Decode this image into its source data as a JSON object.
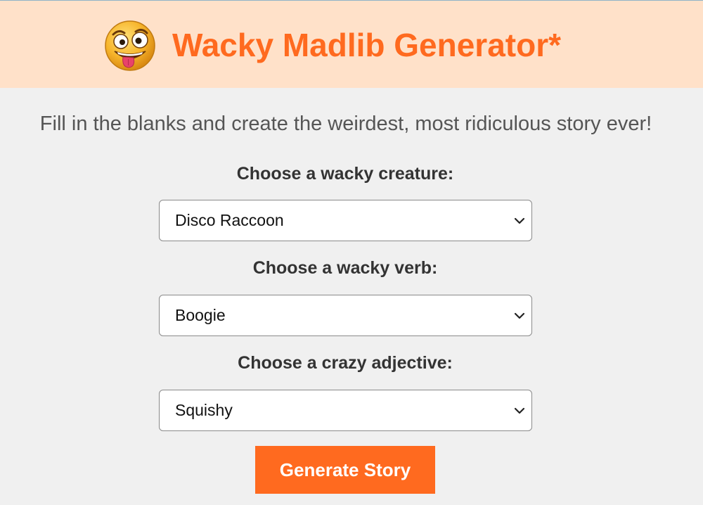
{
  "header": {
    "title": "Wacky Madlib Generator*",
    "logo_icon": "crazy-face-emoji-icon"
  },
  "intro": "Fill in the blanks and create the weirdest, most ridiculous story ever!",
  "form": {
    "creature": {
      "label": "Choose a wacky creature:",
      "selected": "Disco Raccoon"
    },
    "verb": {
      "label": "Choose a wacky verb:",
      "selected": "Boogie"
    },
    "adjective": {
      "label": "Choose a crazy adjective:",
      "selected": "Squishy"
    },
    "submit_label": "Generate Story"
  },
  "colors": {
    "accent": "#ff6a1f",
    "header_bg": "#ffe1c9",
    "page_bg": "#f0f0f0"
  }
}
